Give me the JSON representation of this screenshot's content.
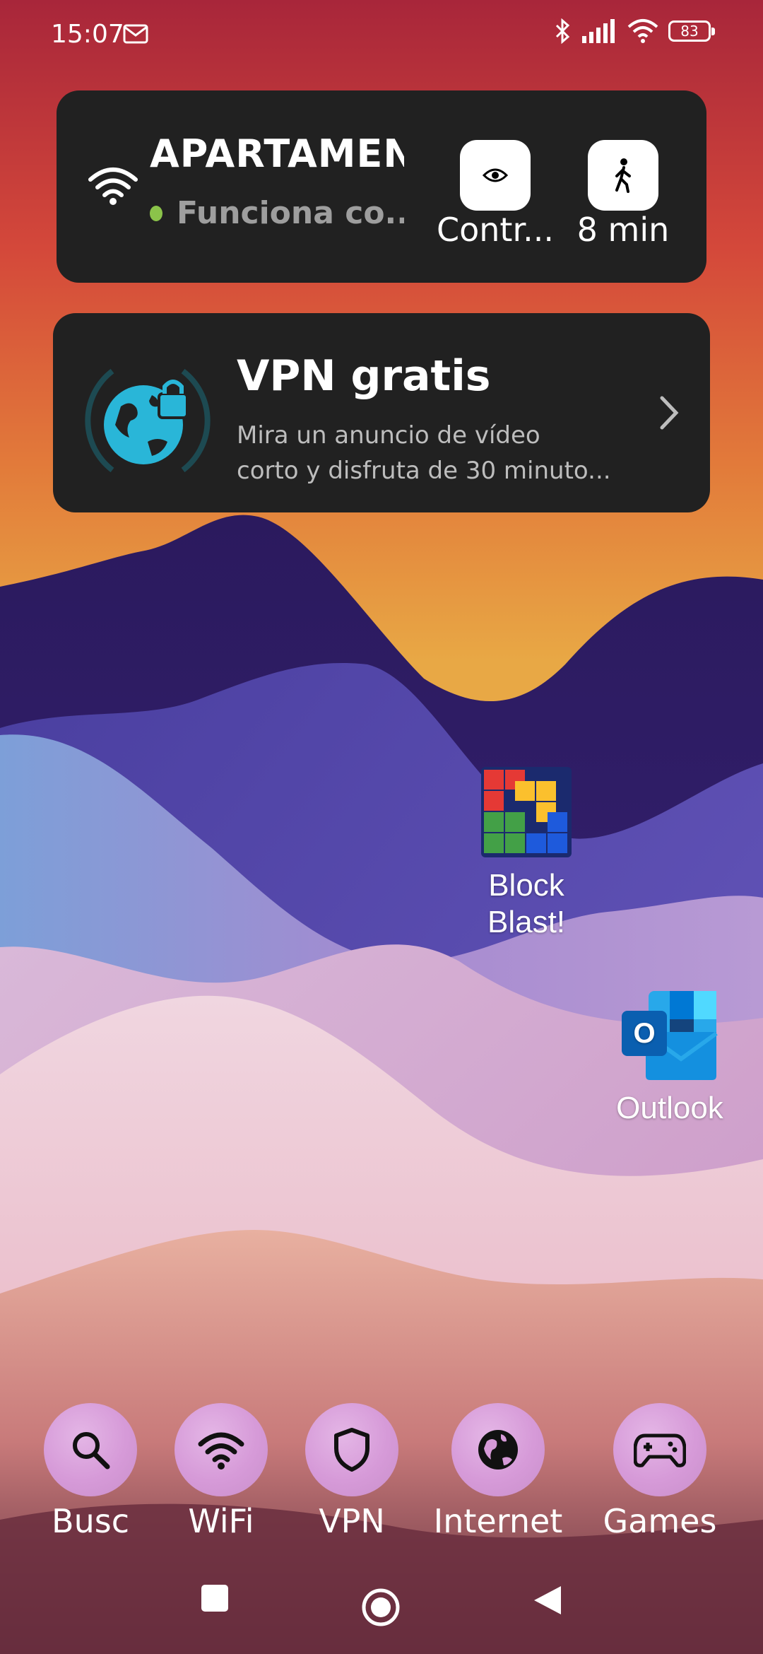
{
  "status_bar": {
    "time": "15:07",
    "battery": "83",
    "icons": [
      "outlook-notification-icon",
      "bluetooth-icon",
      "signal-icon",
      "wifi-icon",
      "battery-icon"
    ]
  },
  "wifi_widget": {
    "network_name": "APARTAMEN..",
    "status": "Funciona co...",
    "status_color": "#8bc34a",
    "buttons": [
      {
        "label": "Contr...",
        "icon": "eye-icon"
      },
      {
        "label": "8 min",
        "icon": "walk-icon"
      }
    ]
  },
  "vpn_widget": {
    "title": "VPN gratis",
    "description_line1": "Mira un anuncio de vídeo",
    "description_line2": "corto y disfruta de 30 minuto...",
    "accent": "#29b6d8"
  },
  "home_apps": [
    {
      "label_line1": "Block",
      "label_line2": "Blast!",
      "icon": "block-blast-icon"
    },
    {
      "label": "Outlook",
      "icon": "outlook-icon"
    }
  ],
  "dock": [
    {
      "label": "Busc",
      "icon": "search-icon"
    },
    {
      "label": "WiFi",
      "icon": "wifi-icon"
    },
    {
      "label": "VPN",
      "icon": "shield-icon"
    },
    {
      "label": "Internet",
      "icon": "globe-icon"
    },
    {
      "label": "Games",
      "icon": "gamepad-icon"
    }
  ],
  "nav_bar": [
    "recents-square-icon",
    "home-circle-icon",
    "back-triangle-icon"
  ]
}
